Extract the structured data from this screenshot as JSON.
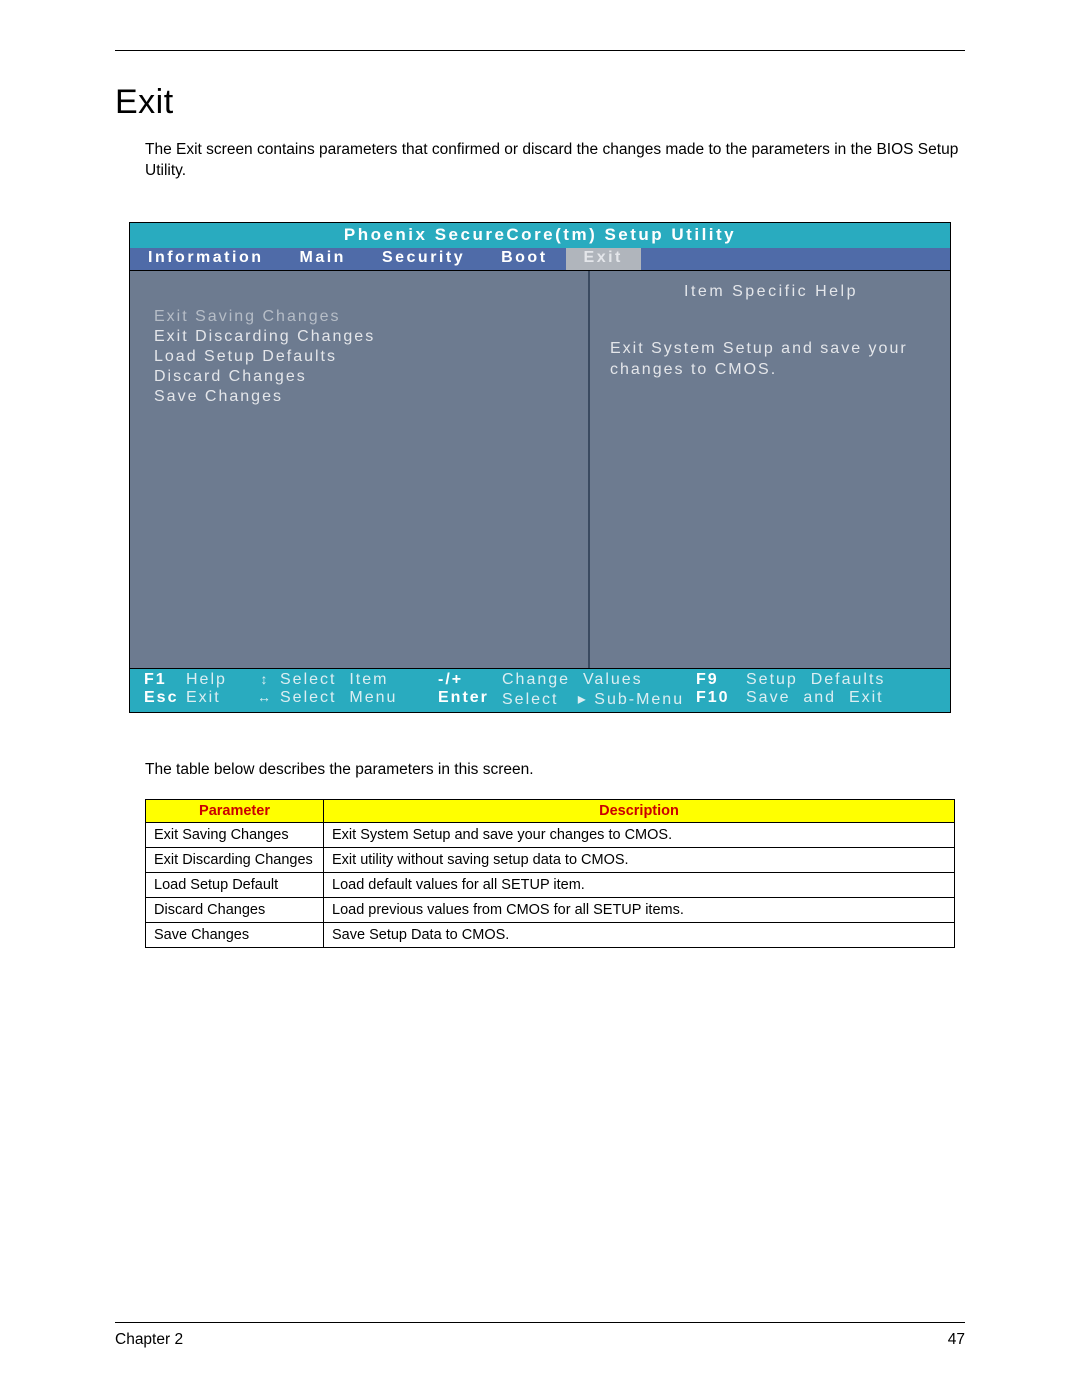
{
  "section": {
    "title": "Exit",
    "intro": "The Exit screen contains parameters that confirmed or discard the changes made to the parameters in the BIOS Setup Utility."
  },
  "bios": {
    "title": "Phoenix  SecureCore(tm)  Setup  Utility",
    "tabs": {
      "info": "Information",
      "main": "Main",
      "security": "Security",
      "boot": "Boot",
      "exit": "Exit"
    },
    "options": {
      "o0": "Exit  Saving  Changes",
      "o1": "Exit  Discarding  Changes",
      "o2": "Load  Setup  Defaults",
      "o3": "Discard  Changes",
      "o4": "Save  Changes"
    },
    "help": {
      "title": "Item  Specific  Help",
      "text": "Exit  System  Setup  and save  your  changes  to CMOS."
    },
    "footer": {
      "r1": {
        "k1": "F1",
        "v1": "Help",
        "a1": "↕",
        "v2": "Select  Item",
        "k2": "-/+",
        "v3": "Change  Values",
        "k3": "F9",
        "v4": "Setup  Defaults"
      },
      "r2": {
        "k1": "Esc",
        "v1": "Exit",
        "a1": "↔",
        "v2": "Select  Menu",
        "k2": "Enter",
        "v3": "Select   ▸ Sub-Menu",
        "k3": "F10",
        "v4": "Save  and  Exit"
      }
    }
  },
  "midtext": "The table below describes the parameters in this screen.",
  "table": {
    "h1": "Parameter",
    "h2": "Description",
    "rows": [
      {
        "p": "Exit Saving Changes",
        "d": "Exit System Setup and save your changes to CMOS."
      },
      {
        "p": "Exit Discarding Changes",
        "d": "Exit utility without saving setup data to CMOS."
      },
      {
        "p": "Load Setup Default",
        "d": "Load default values for all SETUP item."
      },
      {
        "p": "Discard Changes",
        "d": "Load previous values from CMOS for all SETUP items."
      },
      {
        "p": "Save Changes",
        "d": "Save Setup Data to CMOS."
      }
    ]
  },
  "footer": {
    "chapter": "Chapter 2",
    "page": "47"
  }
}
